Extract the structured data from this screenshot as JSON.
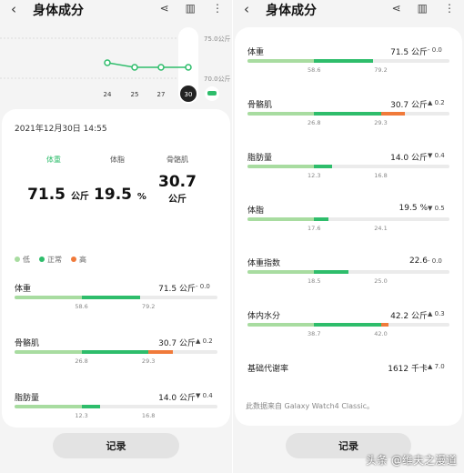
{
  "header": {
    "back": "‹",
    "title": "身体成分"
  },
  "trend": {
    "y_labels": [
      "75.0公斤",
      "70.0公斤"
    ],
    "days": [
      "24",
      "25",
      "27",
      "30"
    ],
    "selected_day": "30"
  },
  "summary": {
    "date": "2021年12月30日 14:55",
    "metrics": [
      {
        "label": "体重",
        "value": "71.5",
        "unit": "公斤"
      },
      {
        "label": "体脂",
        "value": "19.5",
        "unit": "%"
      },
      {
        "label": "骨骼肌",
        "value": "30.7",
        "unit": "公斤"
      }
    ],
    "legend": [
      {
        "label": "低",
        "color": "#a8dca0"
      },
      {
        "label": "正常",
        "color": "#2ebd6b"
      },
      {
        "label": "高",
        "color": "#f07a3a"
      }
    ]
  },
  "rows": [
    {
      "name": "体重",
      "value": "71.5 公斤",
      "change": "- 0.0",
      "low": "58.6",
      "high": "79.2",
      "level": 0.62
    },
    {
      "name": "骨骼肌",
      "value": "30.7 公斤",
      "change": "▲ 0.2",
      "low": "26.8",
      "high": "29.3",
      "level": 0.78
    },
    {
      "name": "脂肪量",
      "value": "14.0 公斤",
      "change": "▼ 0.4",
      "low": "12.3",
      "high": "16.8",
      "level": 0.42
    },
    {
      "name": "体脂",
      "value": "19.5 %",
      "change": "▼ 0.5",
      "low": "17.6",
      "high": "24.1",
      "level": 0.4
    },
    {
      "name": "体重指数",
      "value": "22.6",
      "change": "- 0.0",
      "low": "18.5",
      "high": "25.0",
      "level": 0.5
    },
    {
      "name": "体内水分",
      "value": "42.2 公斤",
      "change": "▲ 0.3",
      "low": "38.7",
      "high": "42.0",
      "level": 0.7
    },
    {
      "name": "基础代谢率",
      "value": "1612 千卡",
      "change": "▲ 7.0"
    }
  ],
  "source_note": "此数据来自 Galaxy Watch4 Classic。",
  "record_button": "记录",
  "watermark": "头条 @维夫之漫道"
}
